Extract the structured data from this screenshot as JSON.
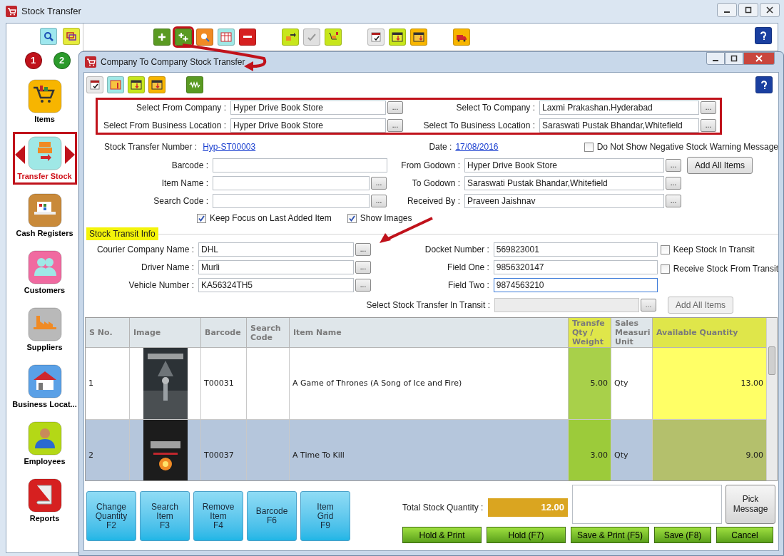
{
  "window": {
    "title": "Stock Transfer"
  },
  "steps": [
    "1",
    "2"
  ],
  "sidebar": {
    "items": [
      {
        "label": "Items",
        "selected": false
      },
      {
        "label": "Transfer Stock",
        "selected": true
      },
      {
        "label": "Cash Registers",
        "selected": false
      },
      {
        "label": "Customers",
        "selected": false
      },
      {
        "label": "Suppliers",
        "selected": false
      },
      {
        "label": "Business Locat...",
        "selected": false
      },
      {
        "label": "Employees",
        "selected": false
      },
      {
        "label": "Reports",
        "selected": false
      }
    ]
  },
  "dialog": {
    "title": "Company To Company Stock Transfer",
    "company_fields": [
      {
        "label": "Select From Company :",
        "value": "Hyper Drive Book Store",
        "lookup": "..."
      },
      {
        "label": "Select To Company :",
        "value": "Laxmi Prakashan.Hyderabad",
        "lookup": "..."
      },
      {
        "label": "Select From Business Location :",
        "value": "Hyper Drive Book Store",
        "lookup": "..."
      },
      {
        "label": "Select To Business Location :",
        "value": "Saraswati Pustak Bhandar,Whitefield",
        "lookup": "..."
      }
    ],
    "transfer_number": {
      "label": "Stock Transfer Number :",
      "value": "Hyp-ST00003"
    },
    "date": {
      "label": "Date :",
      "value": "17/08/2016"
    },
    "negative_warning": {
      "label": "Do Not Show Negative Stock Warning Message",
      "checked": false
    },
    "item_fields": [
      {
        "label": "Barcode :"
      },
      {
        "label": "Item Name :",
        "lookup": "..."
      },
      {
        "label": "Search Code :",
        "lookup": "..."
      }
    ],
    "godown_fields": [
      {
        "label": "From Godown :",
        "value": "Hyper Drive Book Store",
        "lookup": "..."
      },
      {
        "label": "To Godown :",
        "value": "Saraswati Pustak Bhandar,Whitefield",
        "lookup": "..."
      },
      {
        "label": "Received By :",
        "value": "Praveen Jaishnav",
        "lookup": "..."
      }
    ],
    "add_all_items": "Add All Items",
    "options": [
      {
        "label": "Keep Focus on Last Added Item",
        "checked": true
      },
      {
        "label": "Show Images",
        "checked": true
      }
    ],
    "transit": {
      "title": "Stock Transit Info",
      "left_fields": [
        {
          "label": "Courier Company Name :",
          "value": "DHL",
          "lookup": "..."
        },
        {
          "label": "Driver Name :",
          "value": "Murli",
          "lookup": "..."
        },
        {
          "label": "Vehicle Number :",
          "value": "KA56324TH5",
          "lookup": "..."
        }
      ],
      "right_fields": [
        {
          "label": "Docket Number :",
          "value": "569823001",
          "focused": false
        },
        {
          "label": "Field One :",
          "value": "9856320147",
          "focused": false
        },
        {
          "label": "Field Two :",
          "value": "9874563210",
          "focused": true
        }
      ],
      "checkboxes": [
        {
          "label": "Keep Stock In Transit",
          "checked": false
        },
        {
          "label": "Receive Stock From Transit",
          "checked": false
        }
      ],
      "select_in_transit": {
        "label": "Select Stock Transfer In Transit :",
        "lookup": "...",
        "disabled": true
      },
      "add_all_items": {
        "label": "Add All Items",
        "disabled": true
      }
    },
    "table": {
      "columns": [
        {
          "label": "S No.",
          "highlight": false
        },
        {
          "label": "Image",
          "highlight": false
        },
        {
          "label": "Barcode",
          "highlight": false
        },
        {
          "label": "Search\nCode",
          "highlight": false
        },
        {
          "label": "Item Name",
          "highlight": false
        },
        {
          "label": "Transfe\nQty /\nWeight",
          "highlight": true
        },
        {
          "label": "Sales\nMeasuri\nUnit",
          "highlight": false
        },
        {
          "label": "Available Quantity",
          "highlight": true
        }
      ],
      "rows": [
        {
          "sno": "1",
          "barcode": "T00031",
          "item_name": "A Game of Thrones (A Song of Ice and Fire)",
          "qty": "5.00",
          "unit": "Qty",
          "available": "13.00",
          "selected": false
        },
        {
          "sno": "2",
          "barcode": "T00037",
          "item_name": "A Time To Kill",
          "qty": "3.00",
          "unit": "Qty",
          "available": "9.00",
          "selected": true
        }
      ]
    },
    "function_keys": [
      {
        "label": "Change\nQuantity",
        "key": "F2"
      },
      {
        "label": "Search\nItem",
        "key": "F3"
      },
      {
        "label": "Remove\nItem",
        "key": "F4"
      },
      {
        "label": "Barcode",
        "key": "F6"
      },
      {
        "label": "Item\nGrid",
        "key": "F9"
      }
    ],
    "total": {
      "label": "Total Stock Quantity :",
      "value": "12.00"
    },
    "pick_message": "Pick\nMessage",
    "actions": [
      "Hold & Print",
      "Hold (F7)",
      "Save & Print (F5)",
      "Save (F8)",
      "Cancel"
    ]
  }
}
